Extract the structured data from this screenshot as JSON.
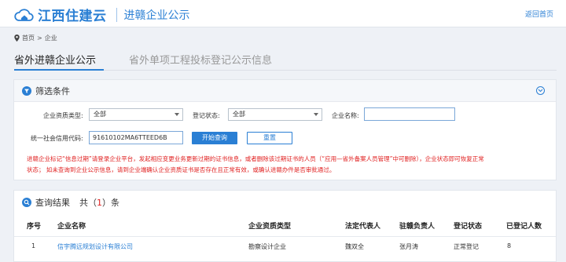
{
  "header": {
    "site_name": "江西住建云",
    "sub_title": "进赣企业公示",
    "home_link": "返回首页"
  },
  "breadcrumb": [
    "首页",
    "企业"
  ],
  "tabs": [
    {
      "label": "省外进赣企业公示",
      "active": true
    },
    {
      "label": "省外单项工程投标登记公示信息",
      "active": false
    }
  ],
  "filter": {
    "title": "筛选条件",
    "qualification_label": "企业资质类型:",
    "qualification_value": "全部",
    "status_label": "登记状态:",
    "status_value": "全部",
    "name_label": "企业名称:",
    "name_value": "",
    "credit_label": "统一社会信用代码:",
    "credit_value": "91610102MA6TTEED6B",
    "search_button": "开始查询",
    "reset_button": "重置",
    "notice_line1": "进赣企业标记“信息过期”请登录企业平台，发起相应变更业务更新过期的证书信息，或者删除该过期证书的人员（“应用—省外备案人员管理”中可删除），企业状态即可恢复正常",
    "notice_line2": "状态；  如未查询到企业公示信息，请到企业端确认企业资质证书是否存在且正常有效，或确认进赣办件是否审批通过。"
  },
  "results": {
    "title": "查询结果",
    "count_prefix": "共（",
    "count": "1",
    "count_suffix": "）条",
    "columns": [
      "序号",
      "企业名称",
      "企业资质类型",
      "法定代表人",
      "驻赣负责人",
      "登记状态",
      "已登记人数"
    ],
    "rows": [
      [
        "1",
        "信宇腾远规划设计有限公司",
        "勘察设计企业",
        "魏双全",
        "张月涛",
        "正常登记",
        "8"
      ]
    ]
  },
  "colors": {
    "accent": "#2a7fd4",
    "warning": "#e02020"
  }
}
